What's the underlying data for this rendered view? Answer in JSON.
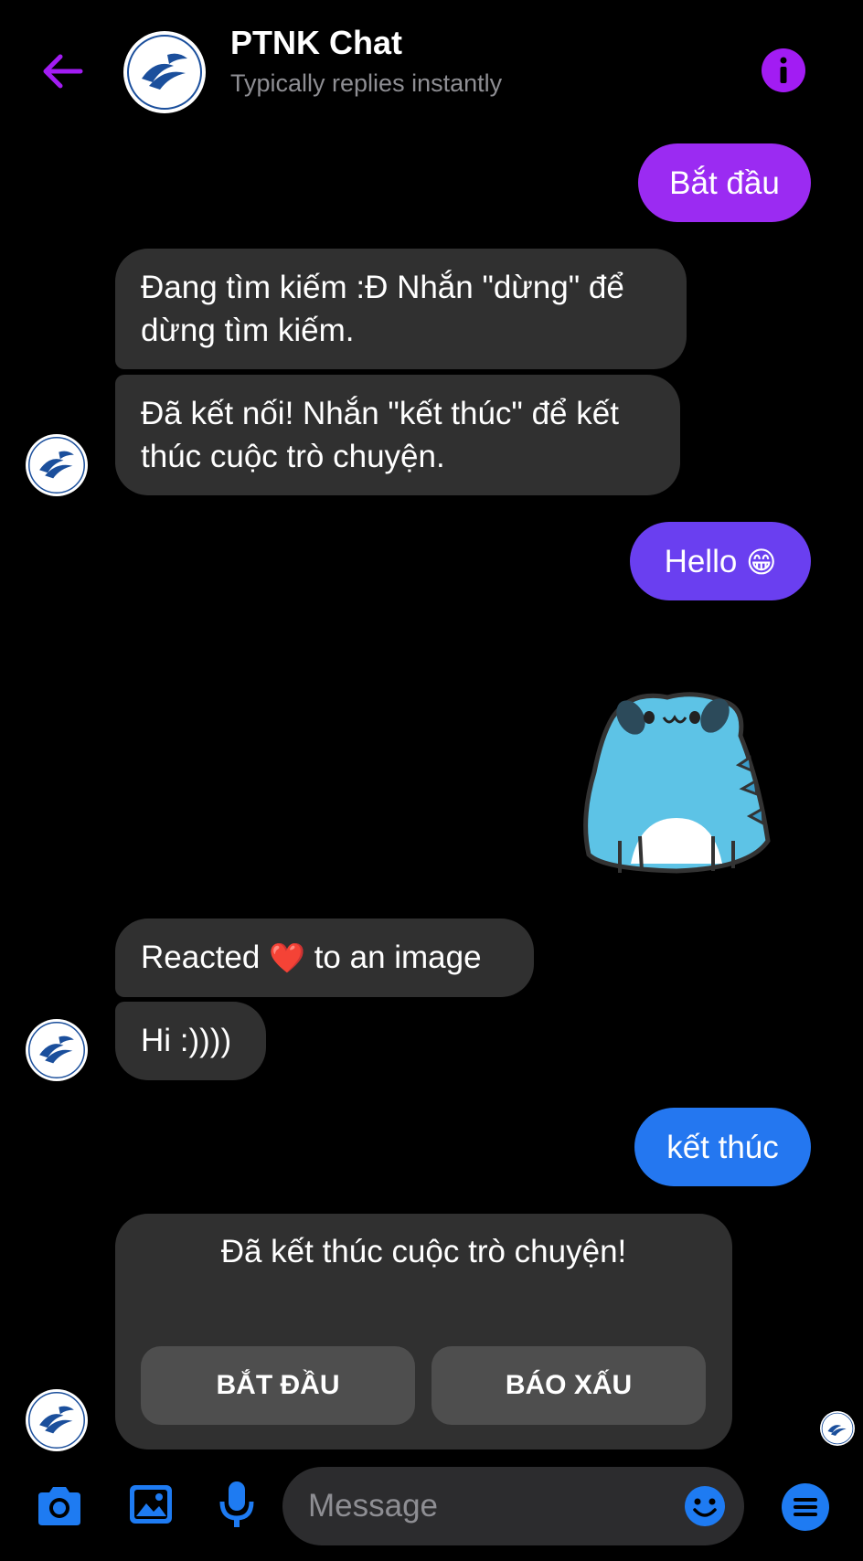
{
  "header": {
    "back_icon": "arrow-left-icon",
    "title": "PTNK Chat",
    "subtitle": "Typically replies instantly",
    "info_icon": "info-icon",
    "accent": "#a21cf3"
  },
  "messages": {
    "m1": "Bắt đầu",
    "m2": "Đang tìm kiếm :Đ Nhắn \"dừng\" để dừng tìm kiếm.",
    "m3": "Đã kết nối! Nhắn \"kết thúc\" để kết thúc cuộc trò chuyện.",
    "m4_text": "Hello",
    "m4_emoji": "😁",
    "sticker": "blue-dinosaur-sticker",
    "m5_pre": "Reacted",
    "m5_emoji": "❤️",
    "m5_post": "to an image",
    "m6": "Hi :))))",
    "m7": "kết thúc"
  },
  "card": {
    "text": "Đã kết thúc cuộc trò chuyện!",
    "button_start": "BẮT ĐẦU",
    "button_report": "BÁO XẤU"
  },
  "composer": {
    "placeholder": "Message",
    "icons": [
      "camera-icon",
      "image-icon",
      "microphone-icon",
      "emoji-icon",
      "menu-icon"
    ],
    "accent": "#1e7bf2"
  },
  "colors": {
    "out_purple": "#9b2bf2",
    "out_violet": "#6a3ff0",
    "out_blue": "#2477f0",
    "in_gray": "#303030"
  }
}
